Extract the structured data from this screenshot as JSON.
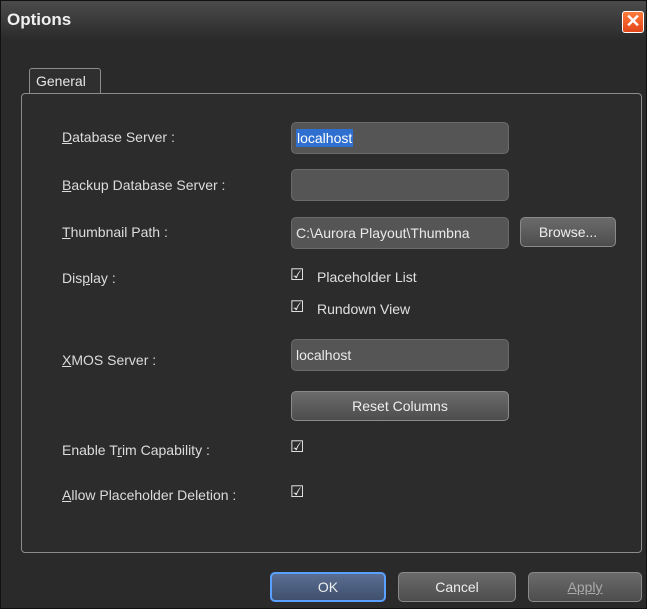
{
  "window": {
    "title": "Options"
  },
  "tabs": [
    {
      "label": "General"
    }
  ],
  "fields": {
    "database_server": {
      "label_u": "D",
      "label_rest": "atabase Server :",
      "value": "localhost"
    },
    "backup_database_server": {
      "label_u": "B",
      "label_rest": "ackup Database Server :",
      "value": ""
    },
    "thumbnail_path": {
      "label_u": "T",
      "label_rest": "humbnail Path :",
      "value": "C:\\Aurora Playout\\Thumbna"
    },
    "display": {
      "label_pre": "Dis",
      "label_u": "p",
      "label_rest": "lay :"
    },
    "xmos_server": {
      "label_u": "X",
      "label_rest": "MOS Server :",
      "value": "localhost"
    },
    "enable_trim": {
      "label_pre": "Enable T",
      "label_u": "r",
      "label_rest": "im Capability :"
    },
    "allow_placeholder_deletion": {
      "label_u": "A",
      "label_rest": "llow Placeholder Deletion :"
    }
  },
  "display_options": {
    "placeholder_list": {
      "label": "Placeholder List",
      "checked": true
    },
    "rundown_view": {
      "label": "Rundown View",
      "checked": true
    }
  },
  "buttons": {
    "browse": "Browse...",
    "reset_columns": "Reset Columns",
    "ok": "OK",
    "cancel": "Cancel",
    "apply": "Apply"
  },
  "icons": {
    "check": "checkmark-icon",
    "close": "close-icon"
  }
}
